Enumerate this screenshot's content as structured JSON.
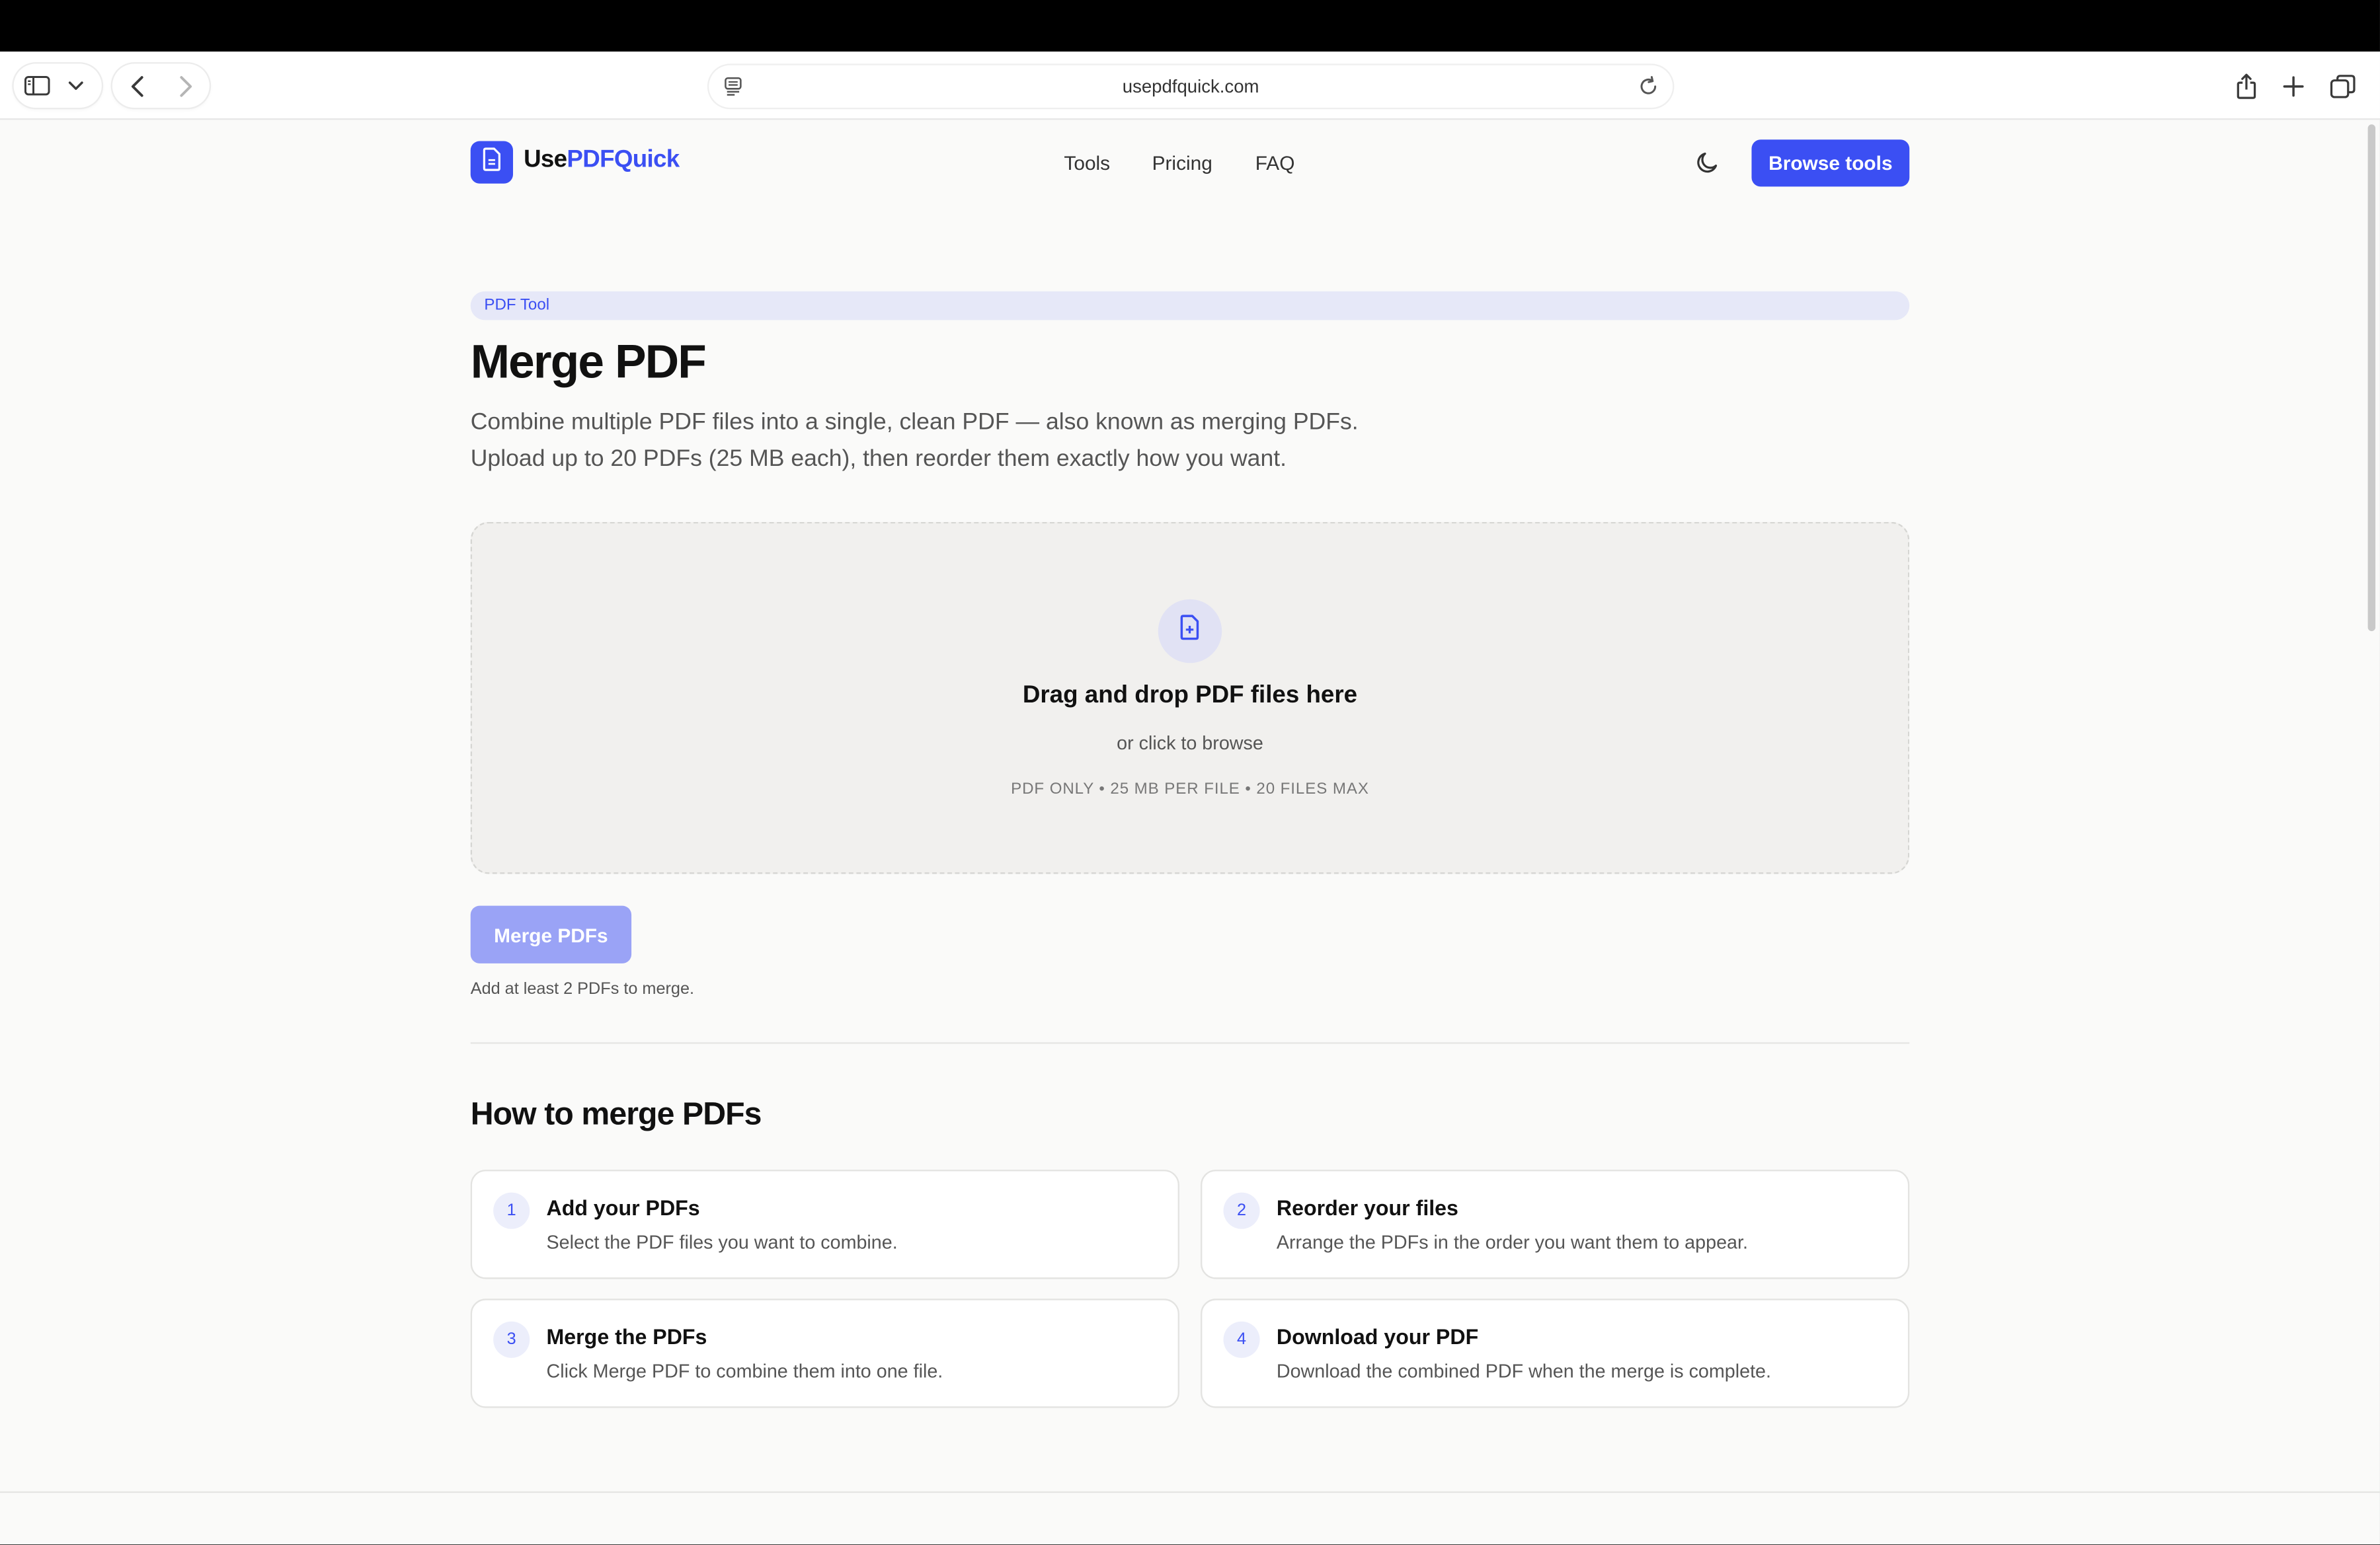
{
  "browser": {
    "url": "usepdfquick.com"
  },
  "header": {
    "brand_prefix": "Use",
    "brand_accent": "PDFQuick",
    "nav": [
      {
        "label": "Tools"
      },
      {
        "label": "Pricing"
      },
      {
        "label": "FAQ"
      }
    ],
    "cta_label": "Browse tools"
  },
  "hero": {
    "tag": "PDF Tool",
    "title": "Merge PDF",
    "description_lines": [
      "Combine multiple PDF files into a single, clean PDF — also known as merging PDFs.",
      "Upload up to 20 PDFs (25 MB each), then reorder them exactly how you want."
    ]
  },
  "dropzone": {
    "title": "Drag and drop PDF files here",
    "subtitle": "or click to browse",
    "note": "PDF ONLY • 25 MB PER FILE • 20 FILES MAX"
  },
  "merge": {
    "button_label": "Merge PDFs",
    "hint": "Add at least 2 PDFs to merge."
  },
  "howto": {
    "title": "How to merge PDFs",
    "steps": [
      {
        "number": "1",
        "title": "Add your PDFs",
        "desc": "Select the PDF files you want to combine."
      },
      {
        "number": "2",
        "title": "Reorder your files",
        "desc": "Arrange the PDFs in the order you want them to appear."
      },
      {
        "number": "3",
        "title": "Merge the PDFs",
        "desc": "Click Merge PDF to combine them into one file."
      },
      {
        "number": "4",
        "title": "Download your PDF",
        "desc": "Download the combined PDF when the merge is complete."
      }
    ]
  },
  "colors": {
    "accent": "#3b4ff3",
    "accent_disabled": "#9aa3f6",
    "page_bg": "#fafaf9"
  }
}
